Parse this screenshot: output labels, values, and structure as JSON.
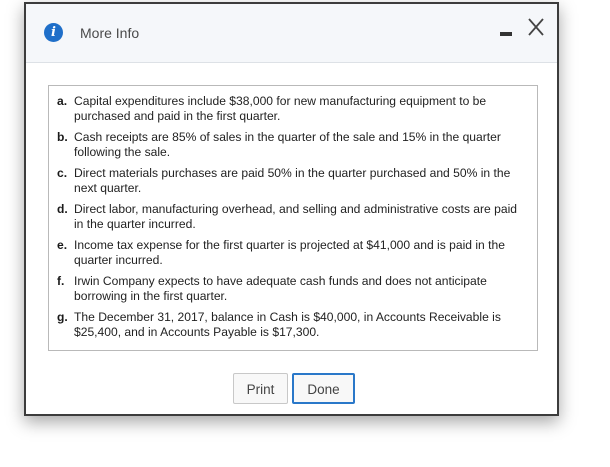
{
  "dialog": {
    "title": "More Info",
    "info_icon_glyph": "i",
    "icons": {
      "info": "info-icon",
      "minimize": "minimize-icon",
      "close": "close-icon"
    },
    "accent_color": "#1f6fc9"
  },
  "items": [
    {
      "letter": "a.",
      "text": "Capital expenditures include $38,000 for new manufacturing equipment to be purchased and paid in the first quarter."
    },
    {
      "letter": "b.",
      "text": "Cash receipts are 85% of sales in the quarter of the sale and 15% in the quarter following the sale."
    },
    {
      "letter": "c.",
      "text": "Direct materials purchases are paid 50% in the quarter purchased and 50% in the next quarter."
    },
    {
      "letter": "d.",
      "text": "Direct labor, manufacturing overhead, and selling and administrative costs are paid in the quarter incurred."
    },
    {
      "letter": "e.",
      "text": "Income tax expense for the first quarter is projected at $41,000 and is paid in the quarter incurred."
    },
    {
      "letter": "f.",
      "text": "Irwin Company expects to have adequate cash funds and does not anticipate borrowing in the first quarter."
    },
    {
      "letter": "g.",
      "text": "The December 31, 2017, balance in Cash is $40,000, in Accounts Receivable is $25,400, and in Accounts Payable is $17,300."
    }
  ],
  "buttons": {
    "print_label": "Print",
    "done_label": "Done"
  }
}
